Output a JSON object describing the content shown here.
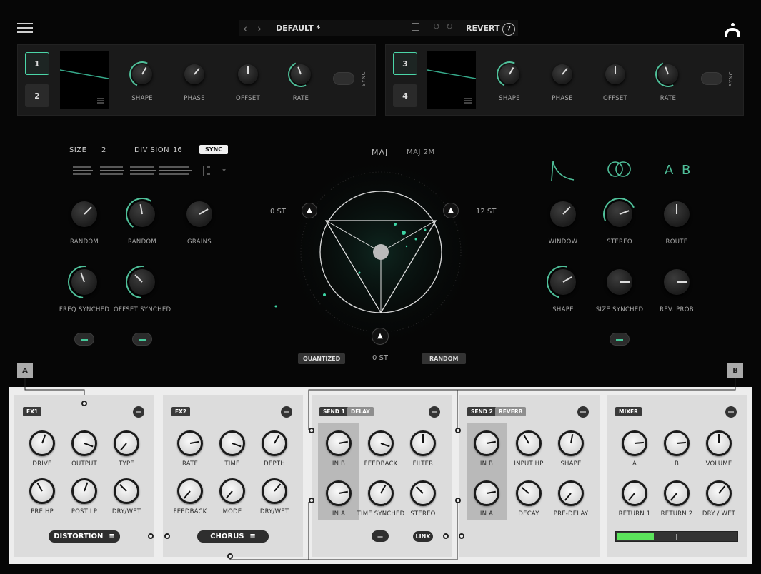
{
  "header": {
    "preset_name": "DEFAULT *",
    "revert_label": "REVERT",
    "help_label": "?"
  },
  "lfo_left": {
    "buttons": [
      "1",
      "2"
    ],
    "knobs": [
      "SHAPE",
      "PHASE",
      "OFFSET",
      "RATE"
    ],
    "sync_label": "SYNC"
  },
  "lfo_right": {
    "buttons": [
      "3",
      "4"
    ],
    "knobs": [
      "SHAPE",
      "PHASE",
      "OFFSET",
      "RATE"
    ],
    "sync_label": "SYNC"
  },
  "grain": {
    "size_label": "SIZE",
    "size_value": "2",
    "division_label": "DIVISION",
    "division_value": "16",
    "sync_label": "SYNC",
    "knobs_row1": [
      "RANDOM",
      "RANDOM",
      "GRAINS"
    ],
    "knobs_row2": [
      "FREQ SYNCHED",
      "OFFSET SYNCHED"
    ]
  },
  "pitch": {
    "chord1": "MAJ",
    "chord2": "MAJ 2M",
    "left_st": "0 ST",
    "right_st": "12 ST",
    "bottom_st": "0 ST",
    "quantized_label": "QUANTIZED",
    "random_label": "RANDOM"
  },
  "window_section": {
    "ab_label": "A B",
    "knobs_row1": [
      "WINDOW",
      "STEREO",
      "ROUTE"
    ],
    "knobs_row2": [
      "SHAPE",
      "SIZE SYNCHED",
      "REV. PROB"
    ]
  },
  "routing": {
    "a_label": "A",
    "b_label": "B"
  },
  "fx1": {
    "tag": "FX1",
    "row1": [
      "DRIVE",
      "OUTPUT",
      "TYPE"
    ],
    "row2": [
      "PRE HP",
      "POST LP",
      "DRY/WET"
    ],
    "selector": "DISTORTION"
  },
  "fx2": {
    "tag": "FX2",
    "row1": [
      "RATE",
      "TIME",
      "DEPTH"
    ],
    "row2": [
      "FEEDBACK",
      "MODE",
      "DRY/WET"
    ],
    "selector": "CHORUS"
  },
  "send1": {
    "tag": "SEND 1",
    "type": "DELAY",
    "row1": [
      "IN B",
      "FEEDBACK",
      "FILTER"
    ],
    "row2": [
      "IN A",
      "TIME SYNCHED",
      "STEREO"
    ],
    "link_label": "LINK"
  },
  "send2": {
    "tag": "SEND 2",
    "type": "REVERB",
    "row1": [
      "IN B",
      "INPUT HP",
      "SHAPE"
    ],
    "row2": [
      "IN A",
      "DECAY",
      "PRE-DELAY"
    ]
  },
  "mixer": {
    "tag": "MIXER",
    "row1": [
      "A",
      "B",
      "VOLUME"
    ],
    "row2": [
      "RETURN 1",
      "RETURN 2",
      "DRY / WET"
    ],
    "meter_level": 0.3
  },
  "colors": {
    "accent": "#4fbf99",
    "meter": "#5be35b"
  }
}
